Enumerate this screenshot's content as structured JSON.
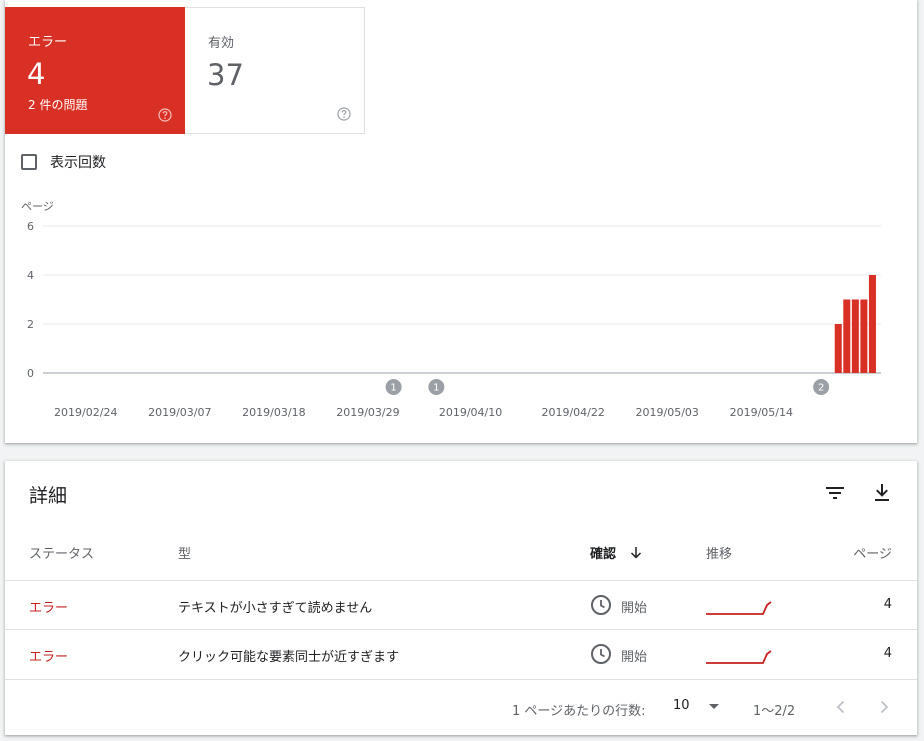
{
  "summary": {
    "error_tile": {
      "label": "エラー",
      "value": "4",
      "subtext": "2 件の問題"
    },
    "valid_tile": {
      "label": "有効",
      "value": "37"
    }
  },
  "metric_toggle": {
    "label": "表示回数",
    "checked": false
  },
  "chart_data": {
    "type": "bar",
    "ylabel": "ページ",
    "yticks": [
      "6",
      "4",
      "2",
      "0"
    ],
    "ylim": [
      0,
      6
    ],
    "xticks": [
      "2019/02/24",
      "2019/03/07",
      "2019/03/18",
      "2019/03/29",
      "2019/04/10",
      "2019/04/22",
      "2019/05/03",
      "2019/05/14"
    ],
    "x": [
      "2019/05/23",
      "2019/05/24",
      "2019/05/25",
      "2019/05/26",
      "2019/05/27"
    ],
    "values": [
      2,
      3,
      3,
      3,
      4
    ],
    "color": "#d93025",
    "grid": true,
    "annotations": [
      {
        "date": "2019/04/01",
        "label": "1"
      },
      {
        "date": "2019/04/06",
        "label": "1"
      },
      {
        "date": "2019/05/21",
        "label": "2"
      }
    ]
  },
  "details": {
    "title": "詳細",
    "columns": {
      "status": "ステータス",
      "type": "型",
      "validation": "確認",
      "trend": "推移",
      "pages": "ページ"
    },
    "rows": [
      {
        "status": "エラー",
        "type": "テキストが小さすぎて読めません",
        "validation": "開始",
        "pages": "4"
      },
      {
        "status": "エラー",
        "type": "クリック可能な要素同士が近すぎます",
        "validation": "開始",
        "pages": "4"
      }
    ],
    "pagination": {
      "rows_per_page_label": "1 ページあたりの行数:",
      "rows_per_page": "10",
      "range": "1〜2/2"
    }
  },
  "colors": {
    "error": "#d93025",
    "error_text": "#c5221f",
    "muted": "#5f6368"
  },
  "icons": {
    "help": "help-circle-icon",
    "filter": "filter-icon",
    "download": "download-icon",
    "sort": "arrow-down-icon",
    "clock": "clock-icon",
    "prev": "chevron-left-icon",
    "next": "chevron-right-icon",
    "dropdown": "dropdown-triangle-icon"
  }
}
